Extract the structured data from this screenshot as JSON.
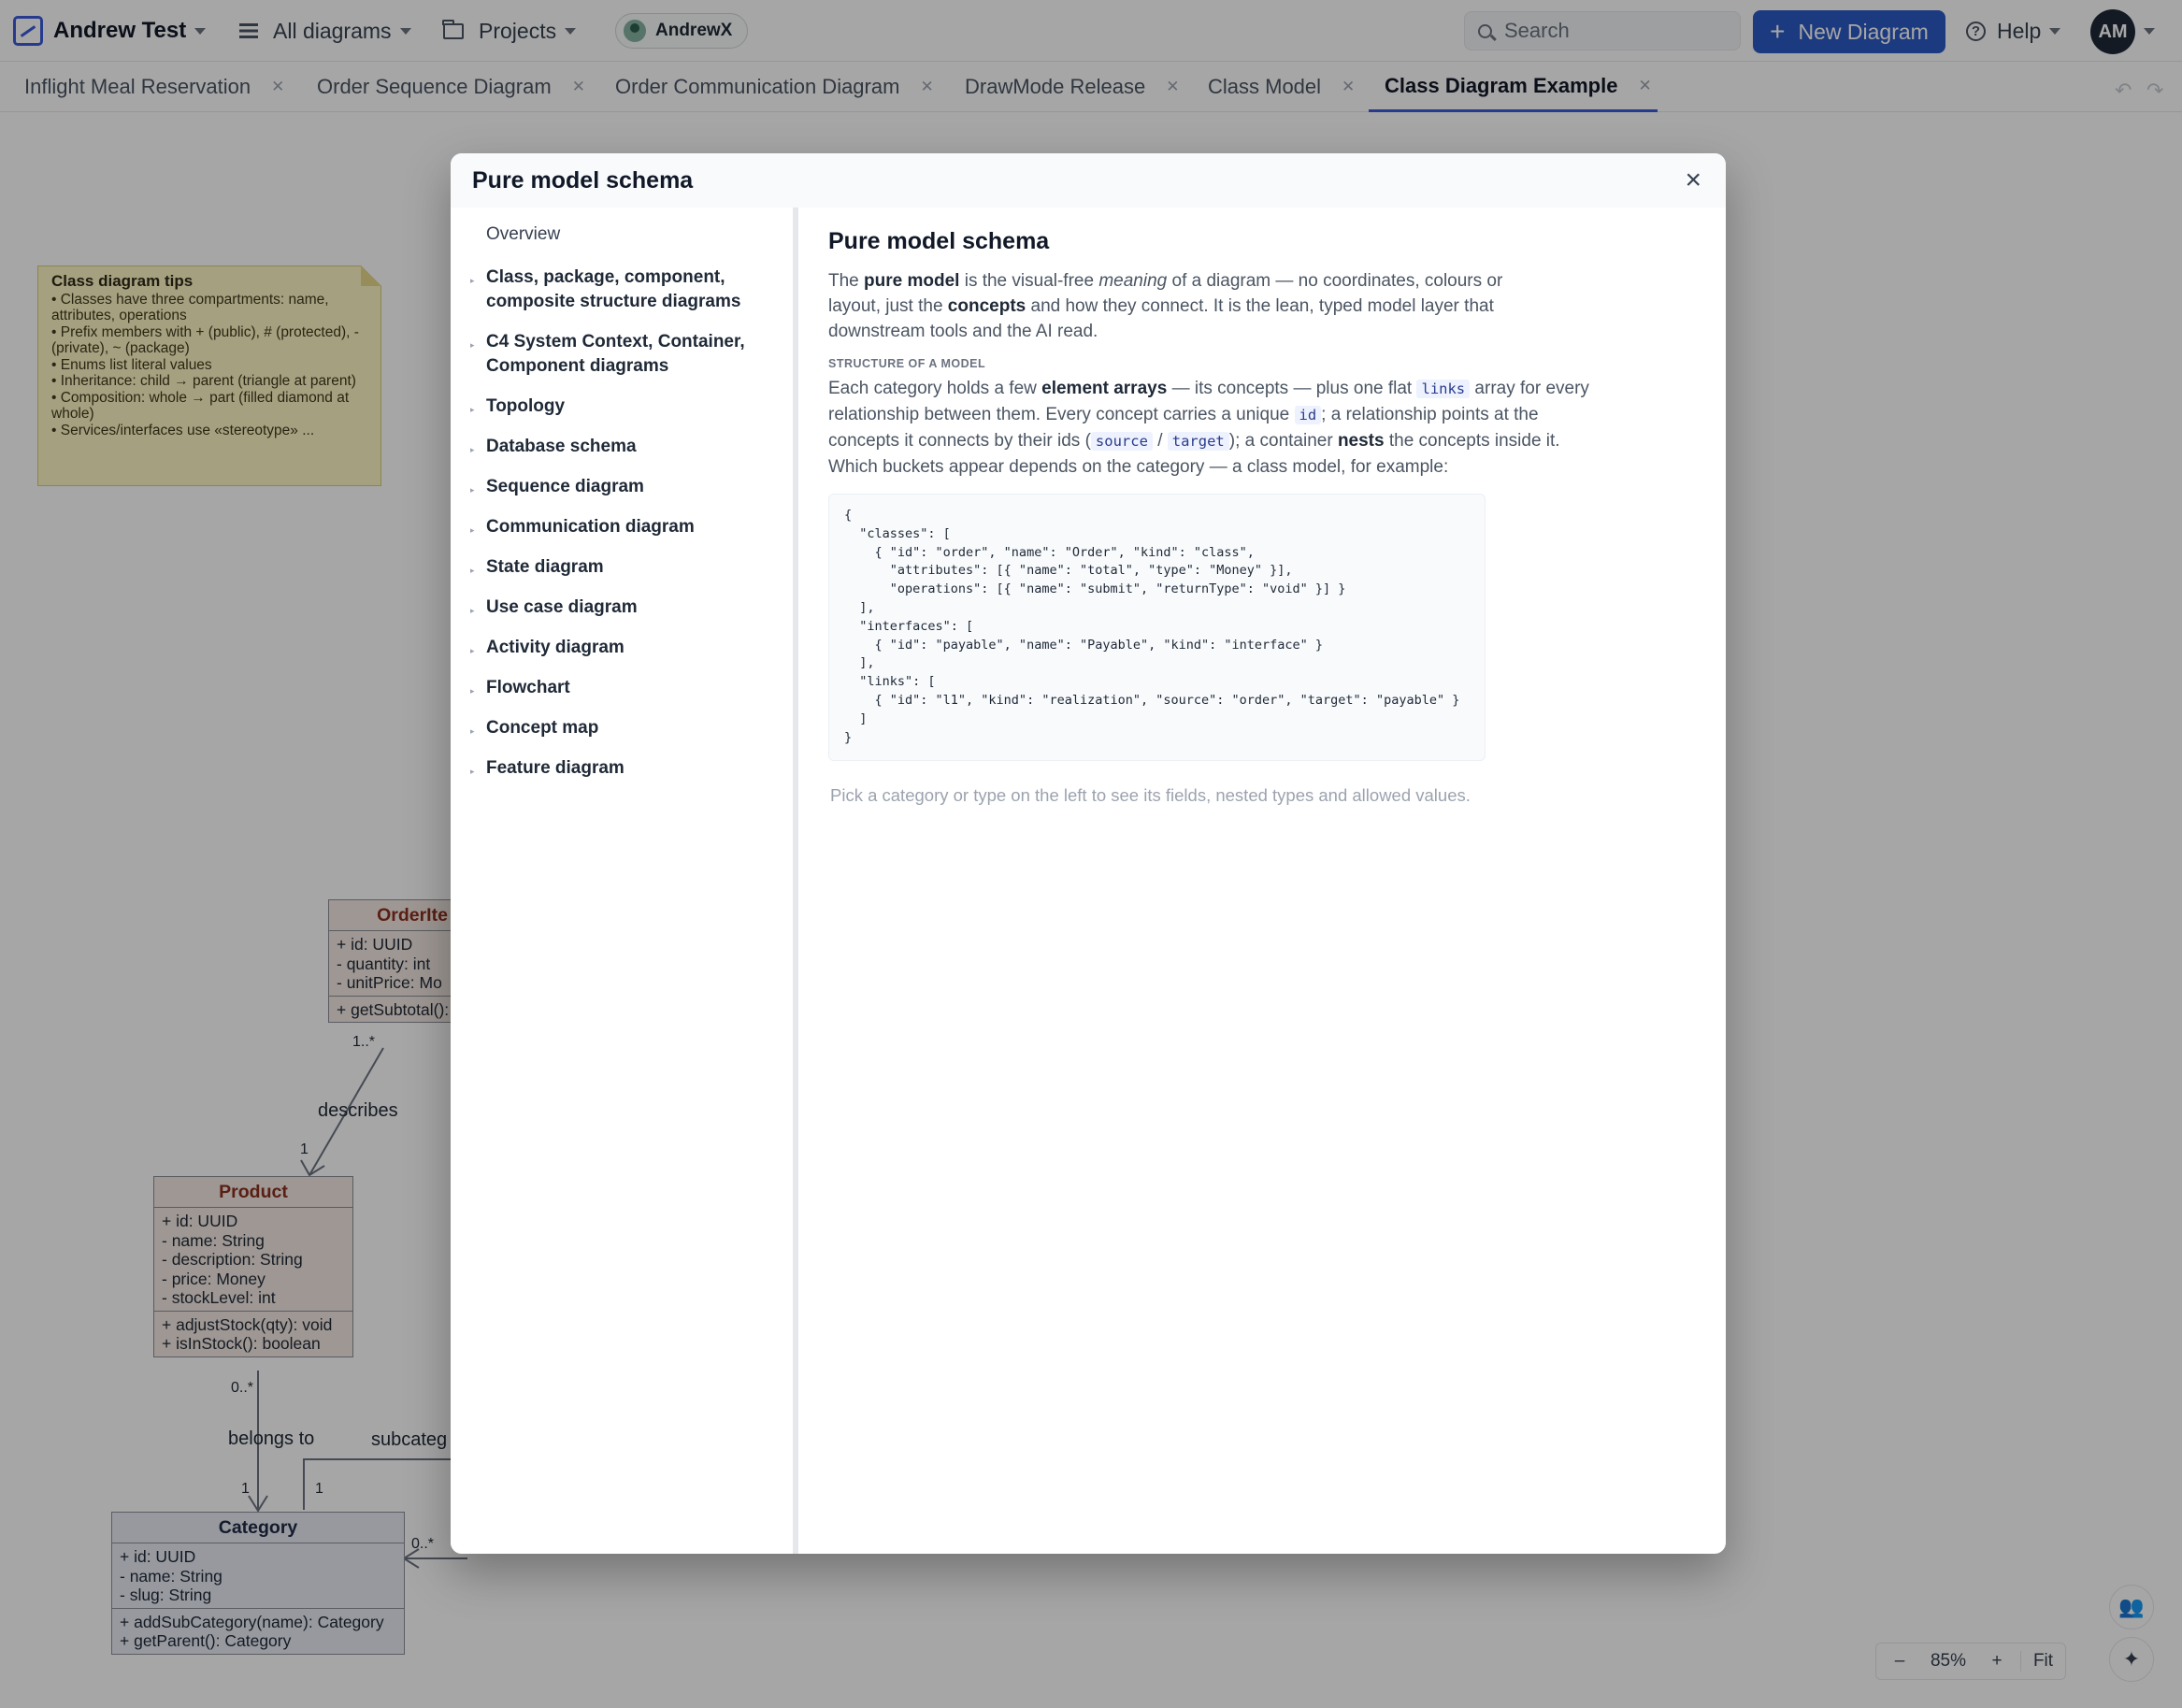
{
  "topbar": {
    "user_name": "Andrew Test",
    "all_diagrams": "All diagrams",
    "projects": "Projects",
    "workspace": "AndrewX",
    "search_placeholder": "Search",
    "new_diagram": "New Diagram",
    "help": "Help",
    "avatar_initials": "AM"
  },
  "tabs": [
    {
      "label": "Inflight Meal Reservation"
    },
    {
      "label": "Order Sequence Diagram"
    },
    {
      "label": "Order Communication Diagram"
    },
    {
      "label": "DrawMode Release"
    },
    {
      "label": "Class Model"
    },
    {
      "label": "Class Diagram Example",
      "active": true
    }
  ],
  "canvas": {
    "note": {
      "title": "Class diagram tips",
      "lines": [
        "• Classes have three compartments: name, attributes, operations",
        "• Prefix members with + (public), # (protected), - (private), ~ (package)",
        "• Enums list literal values",
        "• Inheritance: child → parent (triangle at parent)",
        "• Composition: whole → part (filled diamond at whole)",
        "• Services/interfaces use «stereotype» ..."
      ]
    },
    "classes": {
      "orderitem": {
        "name": "OrderIte",
        "attributes": [
          "+ id: UUID",
          "- quantity: int",
          "- unitPrice: Mo"
        ],
        "operations": [
          "+ getSubtotal():"
        ]
      },
      "product": {
        "name": "Product",
        "attributes": [
          "+ id: UUID",
          "- name: String",
          "- description: String",
          "- price: Money",
          "- stockLevel: int"
        ],
        "operations": [
          "+ adjustStock(qty): void",
          "+ isInStock(): boolean"
        ]
      },
      "category": {
        "name": "Category",
        "attributes": [
          "+ id: UUID",
          "- name: String",
          "- slug: String"
        ],
        "operations": [
          "+ addSubCategory(name): Category",
          "+ getParent(): Category"
        ]
      }
    },
    "edge_labels": {
      "describes": "describes",
      "belongs_to": "belongs to",
      "subcategory": "subcateg"
    },
    "multiplicities": {
      "orderitem_bottom": "1..*",
      "product_top": "1",
      "product_bottom": "0..*",
      "category_top_left": "1",
      "category_top_right": "1",
      "category_side": "0..*"
    },
    "zoom": {
      "minus": "–",
      "level": "85%",
      "plus": "+",
      "fit": "Fit"
    }
  },
  "modal": {
    "title": "Pure model schema",
    "close": "×",
    "sidebar": [
      "Overview",
      "Class, package, component, composite structure diagrams",
      "C4 System Context, Container, Component diagrams",
      "Topology",
      "Database schema",
      "Sequence diagram",
      "Communication diagram",
      "State diagram",
      "Use case diagram",
      "Activity diagram",
      "Flowchart",
      "Concept map",
      "Feature diagram"
    ],
    "content": {
      "heading": "Pure model schema",
      "intro": {
        "t1": "The ",
        "b1": "pure model",
        "t2": " is the visual-free ",
        "i1": "meaning",
        "t3": " of a diagram — no coordinates, colours or layout, just the ",
        "b2": "concepts",
        "t4": " and how they connect. It is the lean, typed model layer that downstream tools and the AI read."
      },
      "section_label": "STRUCTURE OF A MODEL",
      "structure": {
        "t1": "Each category holds a few ",
        "b1": "element arrays",
        "t2": " — its concepts — plus one flat ",
        "c1": "links",
        "t3": " array for every relationship between them. Every concept carries a unique ",
        "c2": "id",
        "t4": "; a relationship points at the concepts it connects by their ids (",
        "c3": "source",
        "t5": " / ",
        "c4": "target",
        "t6": "); a container ",
        "b2": "nests",
        "t7": " the concepts inside it. Which buckets appear depends on the category — a class model, for example:"
      },
      "code": "{\n  \"classes\": [\n    { \"id\": \"order\", \"name\": \"Order\", \"kind\": \"class\",\n      \"attributes\": [{ \"name\": \"total\", \"type\": \"Money\" }],\n      \"operations\": [{ \"name\": \"submit\", \"returnType\": \"void\" }] }\n  ],\n  \"interfaces\": [\n    { \"id\": \"payable\", \"name\": \"Payable\", \"kind\": \"interface\" }\n  ],\n  \"links\": [\n    { \"id\": \"l1\", \"kind\": \"realization\", \"source\": \"order\", \"target\": \"payable\" }\n  ]\n}",
      "hint": "Pick a category or type on the left to see its fields, nested types and allowed values."
    }
  }
}
